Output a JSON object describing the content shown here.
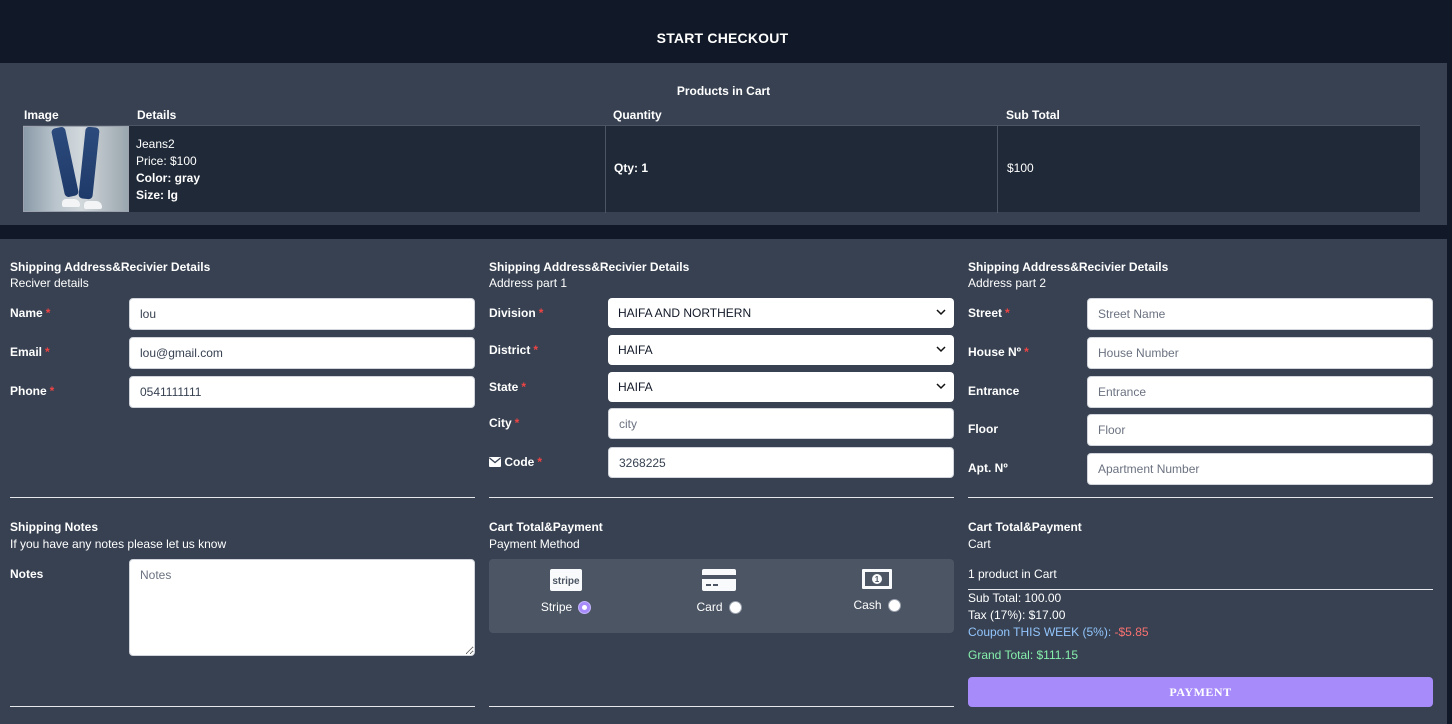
{
  "title": "START CHECKOUT",
  "cart": {
    "title": "Products in Cart",
    "headers": {
      "image": "Image",
      "details": "Details",
      "quantity": "Quantity",
      "subtotal": "Sub Total"
    },
    "item": {
      "name": "Jeans2",
      "price": "Price: $100",
      "color": "Color: gray",
      "size": "Size: lg",
      "qty": "Qty: 1",
      "subtotal": "$100"
    }
  },
  "receiver": {
    "title": "Shipping Address&Recivier Details",
    "subtitle": "Reciver details",
    "name_label": "Name",
    "name_value": "lou",
    "email_label": "Email",
    "email_value": "lou@gmail.com",
    "phone_label": "Phone",
    "phone_value": "0541111111"
  },
  "address1": {
    "title": "Shipping Address&Recivier Details",
    "subtitle": "Address part 1",
    "division_label": "Division",
    "division_value": "HAIFA AND NORTHERN",
    "district_label": "District",
    "district_value": "HAIFA",
    "state_label": "State",
    "state_value": "HAIFA",
    "city_label": "City",
    "city_placeholder": "city",
    "code_label": "Code",
    "code_value": "3268225"
  },
  "address2": {
    "title": "Shipping Address&Recivier Details",
    "subtitle": "Address part 2",
    "street_label": "Street",
    "street_placeholder": "Street Name",
    "house_label": "House Nº",
    "house_placeholder": "House Number",
    "entrance_label": "Entrance",
    "entrance_placeholder": "Entrance",
    "floor_label": "Floor",
    "floor_placeholder": "Floor",
    "apt_label": "Apt. Nº",
    "apt_placeholder": "Apartment Number"
  },
  "notes": {
    "title": "Shipping Notes",
    "subtitle": "If you have any notes please let us know",
    "label": "Notes",
    "placeholder": "Notes"
  },
  "payment": {
    "title": "Cart Total&Payment",
    "subtitle": "Payment Method",
    "options": [
      {
        "label": "Stripe",
        "icon": "stripe-icon",
        "selected": true
      },
      {
        "label": "Card",
        "icon": "credit-card-icon",
        "selected": false
      },
      {
        "label": "Cash",
        "icon": "cash-icon",
        "selected": false
      }
    ]
  },
  "totals": {
    "title": "Cart Total&Payment",
    "subtitle": "Cart",
    "count": "1 product in Cart",
    "subtotal": "Sub Total: 100.00",
    "tax": "Tax (17%): $17.00",
    "coupon": "Coupon THIS WEEK (5%):",
    "discount": "-$5.85",
    "grand": "Grand Total: $111.15",
    "button": "PAYMENT"
  },
  "colors": {
    "accent": "#a78bfa",
    "panel": "#374151",
    "background": "#111827",
    "required": "#ef4444"
  }
}
